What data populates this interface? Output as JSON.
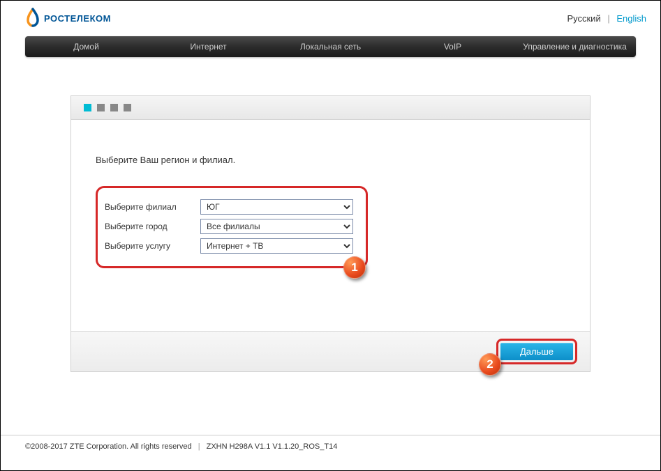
{
  "header": {
    "brand": "РОСТЕЛЕКОМ",
    "lang_ru": "Русский",
    "lang_en": "English"
  },
  "nav": {
    "items": [
      "Домой",
      "Интернет",
      "Локальная сеть",
      "VoIP",
      "Управление и диагностика"
    ]
  },
  "wizard": {
    "instruction": "Выберите Ваш регион и филиал.",
    "fields": {
      "branch": {
        "label": "Выберите филиал",
        "value": "ЮГ"
      },
      "city": {
        "label": "Выберите город",
        "value": "Все филиалы"
      },
      "service": {
        "label": "Выберите услугу",
        "value": "Интернет + ТВ"
      }
    },
    "next_label": "Дальше"
  },
  "badges": {
    "one": "1",
    "two": "2"
  },
  "footer": {
    "copyright": "©2008-2017 ZTE Corporation. All rights reserved",
    "version": "ZXHN H298A V1.1 V1.1.20_ROS_T14"
  }
}
